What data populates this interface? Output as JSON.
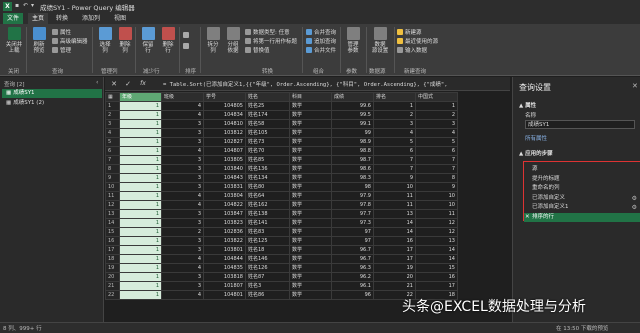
{
  "window": {
    "app_badge": "X",
    "title": "成绩SY1 - Power Query 编辑器"
  },
  "menu_tabs": [
    "文件",
    "主页",
    "转换",
    "添加列",
    "视图"
  ],
  "ribbon": {
    "close_apply": "关闭并\n上载",
    "refresh": "刷新\n预览",
    "properties": "属性",
    "advanced_editor": "高级编辑器",
    "manage": "管理",
    "choose_cols": "选择\n列",
    "remove_cols": "删除\n列",
    "keep_rows": "保留\n行",
    "remove_rows": "删除\n行",
    "sort": "排序",
    "split_col": "拆分\n列",
    "group_by": "分组\n依据",
    "data_type": "数据类型: 任意",
    "first_row_header": "将第一行用作标题",
    "replace_values": "替换值",
    "merge_queries": "合并查询",
    "append_queries": "追加查询",
    "combine_files": "合并文件",
    "manage_params": "管理\n参数",
    "datasource_settings": "数据\n源设置",
    "new_source": "新建源",
    "recent_sources": "最近使用的源",
    "enter_data": "输入数据",
    "groups": {
      "close": "关闭",
      "query": "查询",
      "manage_cols": "管理列",
      "reduce_rows": "减少行",
      "sort": "排序",
      "transform": "转换",
      "combine": "组合",
      "params": "参数",
      "datasource": "数据源",
      "new_query": "新建查询"
    }
  },
  "queries": {
    "header": "查询 [2]",
    "items": [
      "成绩SY1",
      "成绩SY1 (2)"
    ]
  },
  "formula_bar": {
    "fx": "fx",
    "formula": "= Table.Sort(已添加自定义1,{{\"年级\", Order.Ascending}, {\"科目\", Order.Ascending}, {\"成绩\","
  },
  "grid": {
    "headers": [
      "年级",
      "班级",
      "学号",
      "姓名",
      "科目",
      "成绩",
      "排名",
      "中国式"
    ],
    "rows": [
      [
        "1",
        "1",
        "4",
        "104805",
        "姓名25",
        "数学",
        "99.6",
        "1",
        "1"
      ],
      [
        "2",
        "1",
        "4",
        "104834",
        "姓名174",
        "数学",
        "99.5",
        "2",
        "2"
      ],
      [
        "3",
        "1",
        "3",
        "104810",
        "姓名58",
        "数学",
        "99.1",
        "3",
        "3"
      ],
      [
        "4",
        "1",
        "3",
        "103812",
        "姓名105",
        "数学",
        "99",
        "4",
        "4"
      ],
      [
        "5",
        "1",
        "3",
        "102827",
        "姓名73",
        "数学",
        "98.9",
        "5",
        "5"
      ],
      [
        "6",
        "1",
        "4",
        "104807",
        "姓名70",
        "数学",
        "98.8",
        "6",
        "6"
      ],
      [
        "7",
        "1",
        "3",
        "103805",
        "姓名85",
        "数学",
        "98.7",
        "7",
        "7"
      ],
      [
        "8",
        "1",
        "3",
        "103840",
        "姓名136",
        "数学",
        "98.6",
        "7",
        "7"
      ],
      [
        "9",
        "1",
        "3",
        "104843",
        "姓名134",
        "数学",
        "98.3",
        "9",
        "8"
      ],
      [
        "10",
        "1",
        "3",
        "103831",
        "姓名80",
        "数学",
        "98",
        "10",
        "9"
      ],
      [
        "11",
        "1",
        "4",
        "103804",
        "姓名64",
        "数学",
        "97.9",
        "11",
        "10"
      ],
      [
        "12",
        "1",
        "4",
        "104822",
        "姓名162",
        "数学",
        "97.8",
        "11",
        "10"
      ],
      [
        "13",
        "1",
        "3",
        "103847",
        "姓名138",
        "数学",
        "97.7",
        "13",
        "11"
      ],
      [
        "14",
        "1",
        "3",
        "103823",
        "姓名141",
        "数学",
        "97.3",
        "14",
        "12"
      ],
      [
        "15",
        "1",
        "2",
        "102836",
        "姓名83",
        "数学",
        "97",
        "14",
        "12"
      ],
      [
        "16",
        "1",
        "3",
        "103822",
        "姓名125",
        "数学",
        "97",
        "16",
        "13"
      ],
      [
        "17",
        "1",
        "3",
        "103801",
        "姓名18",
        "数学",
        "96.7",
        "17",
        "14"
      ],
      [
        "18",
        "1",
        "4",
        "104844",
        "姓名146",
        "数学",
        "96.7",
        "17",
        "14"
      ],
      [
        "19",
        "1",
        "4",
        "104835",
        "姓名126",
        "数学",
        "96.3",
        "19",
        "15"
      ],
      [
        "20",
        "1",
        "3",
        "103818",
        "姓名87",
        "数学",
        "96.2",
        "20",
        "16"
      ],
      [
        "21",
        "1",
        "3",
        "101807",
        "姓名3",
        "数学",
        "96.1",
        "21",
        "17"
      ],
      [
        "22",
        "1",
        "4",
        "104801",
        "姓名86",
        "数学",
        "96",
        "22",
        "18"
      ]
    ]
  },
  "query_settings": {
    "title": "查询设置",
    "properties_label": "▲ 属性",
    "name_label": "名称",
    "name_value": "成绩SY1",
    "all_properties": "所有属性",
    "applied_steps_label": "▲ 应用的步骤",
    "steps": [
      "源",
      "提升的标题",
      "重命名的列",
      "已添加自定义",
      "已添加自定义1",
      "排序的行"
    ],
    "gear_steps": [
      3,
      4
    ],
    "selected_step": 5
  },
  "status_bar": {
    "left": "8 列、999+ 行",
    "right": "在 13:50 下载的预览"
  },
  "watermark": "头条@EXCEL数据处理与分析",
  "colors": {
    "accent": "#217346",
    "highlight_border": "#dd3333"
  }
}
